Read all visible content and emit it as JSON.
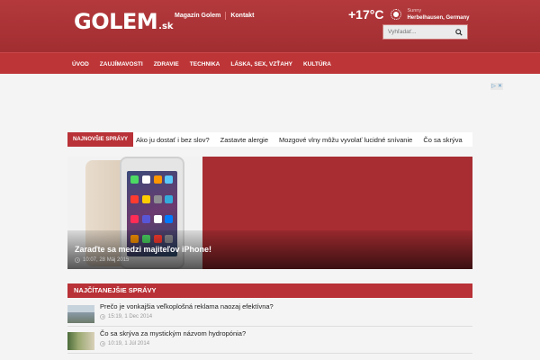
{
  "header": {
    "logo_main": "GOLEM",
    "logo_suffix": ".sk",
    "links": [
      "Magazín Golem",
      "Kontakt"
    ],
    "weather": {
      "temperature": "+17°C",
      "condition": "Sunny",
      "location": "Herbelhausen, Germany",
      "icon": "sun-icon"
    },
    "search": {
      "placeholder": "Vyhľadať..."
    }
  },
  "nav": {
    "items": [
      "ÚVOD",
      "ZAUJÍMAVOSTI",
      "ZDRAVIE",
      "TECHNIKA",
      "LÁSKA, SEX, VZŤAHY",
      "KULTÚRA"
    ]
  },
  "ticker": {
    "label": "NAJNOVŠIE SPRÁVY",
    "items": [
      "Ako ju dostať i bez slov?",
      "Zastavte alergie",
      "Mozgové vlny môžu vyvolať lucidné snívanie",
      "Čo sa skrýva"
    ]
  },
  "featured": {
    "title": "Zaraďte sa medzi majiteľov iPhone!",
    "meta": "10:07, 28 Máj 2015"
  },
  "most_read": {
    "title": "NAJČÍTANEJŠIE SPRÁVY",
    "items": [
      {
        "title": "Prečo je vonkajšia veľkoplošná reklama naozaj efektívna?",
        "meta": "15:19, 1 Dec 2014"
      },
      {
        "title": "Čo sa skrýva za mystickým názvom hydropónia?",
        "meta": "10:19, 1 Júl 2014"
      }
    ]
  },
  "colors": {
    "brand": "#b83237",
    "header": "#a8313a",
    "nav": "#bd3537"
  }
}
